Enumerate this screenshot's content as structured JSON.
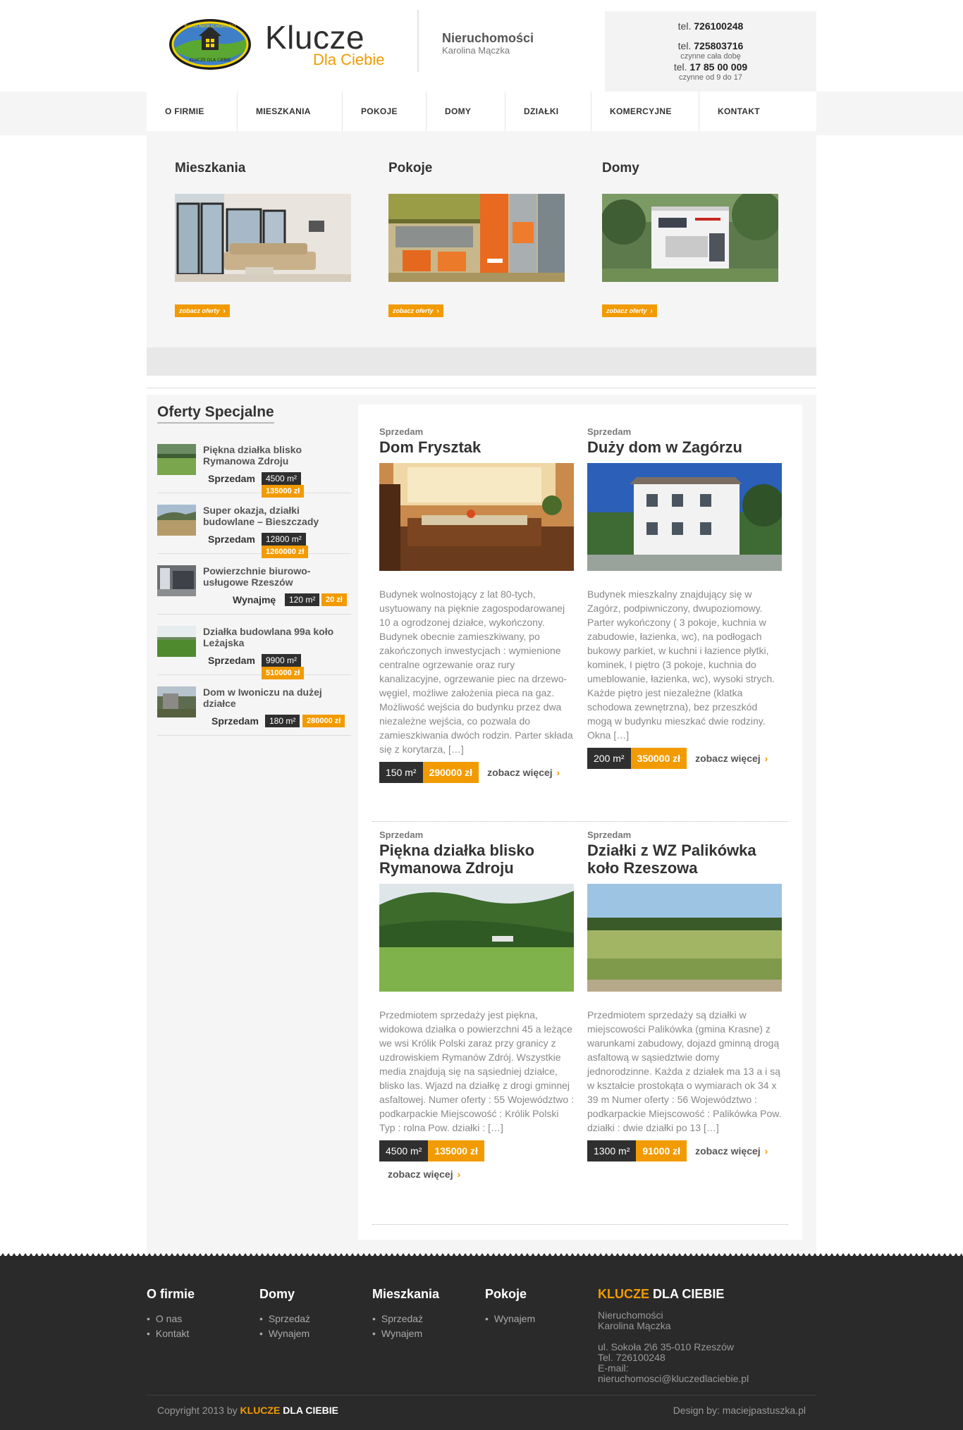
{
  "header": {
    "logo_text_top": "BIURO NIERUCHOMOŚCI",
    "logo_text_bottom": "KLUCZE DLA CIEBIE",
    "brand_title": "Klucze",
    "brand_subtitle": "Dla Ciebie",
    "company": "Nieruchomości",
    "person": "Karolina Mączka",
    "contact": {
      "tel_label": "tel.",
      "phone1": "726100248",
      "phone2": "725803716",
      "phone2_note": "czynne cała dobę",
      "phone3": "17 85 00 009",
      "phone3_note": "czynne od 9 do 17"
    }
  },
  "nav": [
    {
      "label": "O FIRMIE"
    },
    {
      "label": "MIESZKANIA"
    },
    {
      "label": "POKOJE"
    },
    {
      "label": "DOMY"
    },
    {
      "label": "DZIAŁKI"
    },
    {
      "label": "KOMERCYJNE"
    },
    {
      "label": "KONTAKT"
    }
  ],
  "featured": [
    {
      "title": "Mieszkania",
      "button": "zobacz oferty"
    },
    {
      "title": "Pokoje",
      "button": "zobacz oferty"
    },
    {
      "title": "Domy",
      "button": "zobacz oferty"
    }
  ],
  "sidebar": {
    "title": "Oferty Specjalne",
    "items": [
      {
        "title": "Piękna działka blisko Rymanowa Zdroju",
        "action": "Sprzedam",
        "area": "4500 m²",
        "price": "135000 zł"
      },
      {
        "title": "Super okazja, działki budowlane – Bieszczady",
        "action": "Sprzedam",
        "area": "12800 m²",
        "price": "1260000 zł"
      },
      {
        "title": "Powierzchnie biurowo-usługowe Rzeszów",
        "action": "Wynajmę",
        "area": "120 m²",
        "price": "20 zł"
      },
      {
        "title": "Działka budowlana 99a koło Leżajska",
        "action": "Sprzedam",
        "area": "9900 m²",
        "price": "510000 zł"
      },
      {
        "title": "Dom w Iwoniczu na dużej działce",
        "action": "Sprzedam",
        "area": "180 m²",
        "price": "280000 zł"
      }
    ]
  },
  "listings": [
    {
      "label": "Sprzedam",
      "title": "Dom Frysztak",
      "desc": "Budynek wolnostojący z lat 80-tych, usytuowany na pięknie zagospodarowanej 10 a ogrodzonej działce, wykończony. Budynek obecnie zamieszkiwany, po zakończonych inwestycjach : wymienione centralne ogrzewanie oraz rury kanalizacyjne, ogrzewanie piec na drzewo-węgiel, możliwe założenia pieca na gaz. Możliwość wejścia do budynku przez dwa niezależne wejścia, co pozwala do zamieszkiwania dwóch rodzin. Parter składa się z korytarza, […]",
      "area": "150 m²",
      "price": "290000 zł",
      "more": "zobacz więcej"
    },
    {
      "label": "Sprzedam",
      "title": "Duży dom w Zagórzu",
      "desc": "Budynek mieszkalny znajdujący się w Zagórz, podpiwniczony, dwupoziomowy. Parter wykończony ( 3 pokoje, kuchnia w zabudowie, łazienka, wc), na podłogach bukowy parkiet, w kuchni i łazience płytki, kominek, I piętro (3 pokoje, kuchnia do umeblowanie, łazienka, wc), wysoki strych. Każde piętro jest niezależne (klatka schodowa zewnętrzna), bez przeszkód mogą w budynku mieszkać dwie rodziny. Okna […]",
      "area": "200 m²",
      "price": "350000 zł",
      "more": "zobacz więcej"
    },
    {
      "label": "Sprzedam",
      "title": "Piękna działka blisko Rymanowa Zdroju",
      "desc": "Przedmiotem sprzedaży jest piękna, widokowa działka o powierzchni 45 a leżące we wsi Królik Polski zaraz przy granicy z uzdrowiskiem Rymanów Zdrój. Wszystkie media znajdują się na sąsiedniej działce, blisko las. Wjazd na działkę z drogi gminnej asfaltowej. Numer oferty : 55 Województwo : podkarpackie Miejscowość : Królik Polski Typ : rolna Pow. działki : […]",
      "area": "4500 m²",
      "price": "135000 zł",
      "more": "zobacz więcej"
    },
    {
      "label": "Sprzedam",
      "title": "Działki z WZ Palikówka koło Rzeszowa",
      "desc": "Przedmiotem sprzedaży są działki w miejscowości Palikówka (gmina Krasne) z warunkami zabudowy, dojazd gminną drogą asfaltową w sąsiedztwie domy jednorodzinne. Każda z działek ma 13 a i są w kształcie prostokąta o wymiarach ok 34 x 39 m Numer oferty : 56 Województwo : podkarpackie Miejscowość : Palikówka Pow. działki : dwie działki po 13 […]",
      "area": "1300 m²",
      "price": "91000 zł",
      "more": "zobacz więcej"
    }
  ],
  "footer": {
    "col1": {
      "title": "O firmie",
      "items": [
        "O nas",
        "Kontakt"
      ]
    },
    "col2": {
      "title": "Domy",
      "items": [
        "Sprzedaż",
        "Wynajem"
      ]
    },
    "col3": {
      "title": "Mieszkania",
      "items": [
        "Sprzedaż",
        "Wynajem"
      ]
    },
    "col4": {
      "title": "Pokoje",
      "items": [
        "Wynajem"
      ]
    },
    "brand": {
      "title_accent": "KLUCZE",
      "title_rest": "DLA CIEBIE",
      "company": "Nieruchomości",
      "person": "Karolina Mączka",
      "address": "ul. Sokoła 2\\6 35-010 Rzeszów",
      "tel": "Tel. 726100248",
      "email_label": "E-mail:",
      "email": "nieruchomosci@kluczedlaciebie.pl"
    },
    "copyright_prefix": "Copyright 2013 by",
    "copyright_accent": "KLUCZE",
    "copyright_rest": "DLA CIEBIE",
    "design": "Design by: maciejpastuszka.pl"
  },
  "colors": {
    "accent": "#f29b00",
    "dark": "#2f2f2f",
    "footer_bg": "#2a2a2a"
  }
}
